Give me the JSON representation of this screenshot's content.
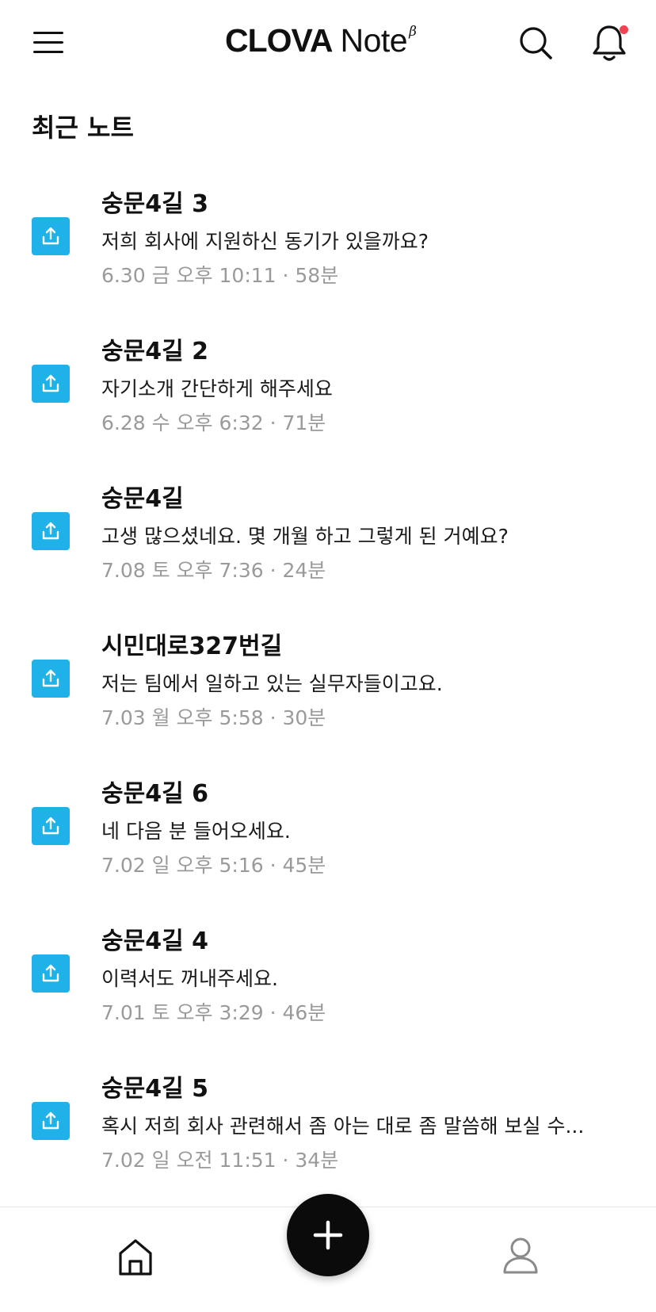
{
  "app": {
    "logo_primary": "CLOVA",
    "logo_secondary": "Note",
    "logo_beta": "β"
  },
  "section": {
    "title": "최근 노트"
  },
  "notes": [
    {
      "title": "숭문4길 3",
      "preview": "저희 회사에 지원하신 동기가 있을까요?",
      "meta": "6.30 금 오후 10:11 · 58분"
    },
    {
      "title": "숭문4길 2",
      "preview": "자기소개 간단하게 해주세요",
      "meta": "6.28 수 오후 6:32 · 71분"
    },
    {
      "title": "숭문4길",
      "preview": "고생 많으셨네요. 몇 개월 하고 그렇게 된 거예요?",
      "meta": "7.08 토 오후 7:36 · 24분"
    },
    {
      "title": "시민대로327번길",
      "preview": "저는 팀에서 일하고 있는 실무자들이고요.",
      "meta": "7.03 월 오후 5:58 · 30분"
    },
    {
      "title": "숭문4길 6",
      "preview": "네 다음 분 들어오세요.",
      "meta": "7.02 일 오후 5:16 · 45분"
    },
    {
      "title": "숭문4길 4",
      "preview": "이력서도 꺼내주세요.",
      "meta": "7.01 토 오후 3:29 · 46분"
    },
    {
      "title": "숭문4길 5",
      "preview": "혹시 저희 회사 관련해서 좀 아는 대로 좀 말씀해 보실 수...",
      "meta": "7.02 일 오전 11:51 · 34분"
    }
  ],
  "icons": {
    "menu": "hamburger-menu-icon",
    "search": "search-icon",
    "notification": "bell-icon",
    "note_type": "upload-icon",
    "home": "home-icon",
    "add": "plus-icon",
    "profile": "user-icon"
  },
  "colors": {
    "accent": "#1eb2e8",
    "notification_dot": "#f04452",
    "meta_text": "#9a9a9a",
    "fab": "#0b0b0b"
  }
}
